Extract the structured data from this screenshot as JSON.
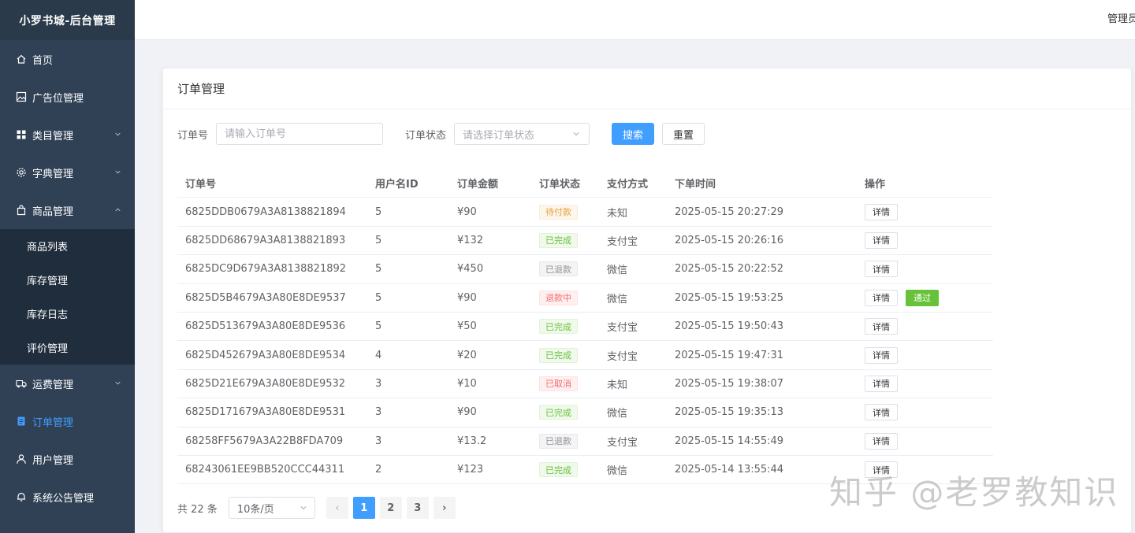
{
  "app": {
    "title": "小罗书城-后台管理"
  },
  "header": {
    "user": "管理员"
  },
  "sidebar": {
    "items": [
      {
        "label": "首页",
        "icon": "home-icon"
      },
      {
        "label": "广告位管理",
        "icon": "image-icon"
      },
      {
        "label": "类目管理",
        "icon": "grid-icon",
        "expandable": true
      },
      {
        "label": "字典管理",
        "icon": "gear-icon",
        "expandable": true
      },
      {
        "label": "商品管理",
        "icon": "bag-icon",
        "expandable": true,
        "expanded": true,
        "children": [
          "商品列表",
          "库存管理",
          "库存日志",
          "评价管理"
        ]
      },
      {
        "label": "运费管理",
        "icon": "truck-icon",
        "expandable": true
      },
      {
        "label": "订单管理",
        "icon": "document-icon",
        "active": true
      },
      {
        "label": "用户管理",
        "icon": "user-icon"
      },
      {
        "label": "系统公告管理",
        "icon": "bell-icon"
      }
    ]
  },
  "card": {
    "title": "订单管理"
  },
  "filter": {
    "order_no_label": "订单号",
    "order_no_placeholder": "请输入订单号",
    "status_label": "订单状态",
    "status_placeholder": "请选择订单状态",
    "search_label": "搜索",
    "reset_label": "重置"
  },
  "table": {
    "headers": [
      "订单号",
      "用户名ID",
      "订单金额",
      "订单状态",
      "支付方式",
      "下单时间",
      "操作"
    ],
    "detail_label": "详情",
    "approve_label": "通过",
    "rows": [
      {
        "order_no": "6825DDB0679A3A8138821894",
        "user_id": "5",
        "amount": "¥90",
        "status": "待付款",
        "status_type": "warning",
        "pay": "未知",
        "time": "2025-05-15 20:27:29"
      },
      {
        "order_no": "6825DD68679A3A8138821893",
        "user_id": "5",
        "amount": "¥132",
        "status": "已完成",
        "status_type": "success",
        "pay": "支付宝",
        "time": "2025-05-15 20:26:16"
      },
      {
        "order_no": "6825DC9D679A3A8138821892",
        "user_id": "5",
        "amount": "¥450",
        "status": "已退款",
        "status_type": "info",
        "pay": "微信",
        "time": "2025-05-15 20:22:52"
      },
      {
        "order_no": "6825D5B4679A3A80E8DE9537",
        "user_id": "5",
        "amount": "¥90",
        "status": "退款中",
        "status_type": "danger",
        "pay": "微信",
        "time": "2025-05-15 19:53:25",
        "approve": true
      },
      {
        "order_no": "6825D513679A3A80E8DE9536",
        "user_id": "5",
        "amount": "¥50",
        "status": "已完成",
        "status_type": "success",
        "pay": "支付宝",
        "time": "2025-05-15 19:50:43"
      },
      {
        "order_no": "6825D452679A3A80E8DE9534",
        "user_id": "4",
        "amount": "¥20",
        "status": "已完成",
        "status_type": "success",
        "pay": "支付宝",
        "time": "2025-05-15 19:47:31"
      },
      {
        "order_no": "6825D21E679A3A80E8DE9532",
        "user_id": "3",
        "amount": "¥10",
        "status": "已取消",
        "status_type": "danger",
        "pay": "未知",
        "time": "2025-05-15 19:38:07"
      },
      {
        "order_no": "6825D171679A3A80E8DE9531",
        "user_id": "3",
        "amount": "¥90",
        "status": "已完成",
        "status_type": "success",
        "pay": "微信",
        "time": "2025-05-15 19:35:13"
      },
      {
        "order_no": "68258FF5679A3A22B8FDA709",
        "user_id": "3",
        "amount": "¥13.2",
        "status": "已退款",
        "status_type": "info",
        "pay": "支付宝",
        "time": "2025-05-15 14:55:49"
      },
      {
        "order_no": "68243061EE9BB520CCC44311",
        "user_id": "2",
        "amount": "¥123",
        "status": "已完成",
        "status_type": "success",
        "pay": "微信",
        "time": "2025-05-14 13:55:44"
      }
    ]
  },
  "pagination": {
    "total_text": "共 22 条",
    "page_size": "10条/页",
    "pages": [
      "1",
      "2",
      "3"
    ],
    "current": "1",
    "prev": "‹",
    "next": "›"
  },
  "watermark": "知乎 @老罗教知识",
  "colors": {
    "primary": "#409eff",
    "sidebar_bg": "#304156",
    "success": "#67c23a",
    "warning": "#e6a23c",
    "danger": "#f56c6c",
    "info": "#909399"
  }
}
